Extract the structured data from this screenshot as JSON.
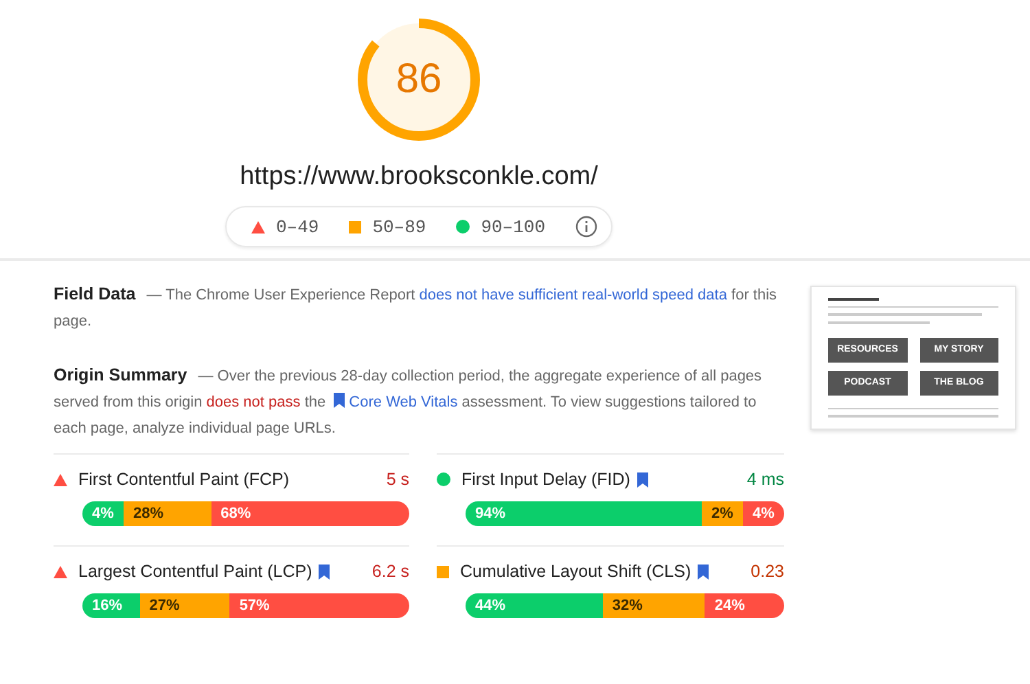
{
  "score": {
    "value": "86",
    "kind": "average"
  },
  "url": "https://www.brooksconkle.com/",
  "legend": [
    {
      "kind": "fail",
      "label": "0–49"
    },
    {
      "kind": "average",
      "label": "50–89"
    },
    {
      "kind": "pass",
      "label": "90–100"
    }
  ],
  "field_data": {
    "title": "Field Data",
    "parts": [
      {
        "kind": "plain",
        "text": "— The Chrome User Experience Report "
      },
      {
        "kind": "link",
        "text": "does not have sufficient real-world speed data"
      },
      {
        "kind": "plain",
        "text": " for this page."
      }
    ]
  },
  "origin_summary": {
    "title": "Origin Summary",
    "parts": [
      {
        "kind": "plain",
        "text": "— Over the previous 28-day collection period, the aggregate experience of all pages served from this origin "
      },
      {
        "kind": "warning",
        "text": "does not pass"
      },
      {
        "kind": "plain",
        "text": " the "
      },
      {
        "kind": "vitals-link",
        "text": "Core Web Vitals"
      },
      {
        "kind": "plain",
        "text": " assessment. To view suggestions tailored to each page, analyze individual page URLs."
      }
    ]
  },
  "thumbnail": {
    "tiles": [
      "RESOURCES",
      "MY STORY",
      "PODCAST",
      "THE BLOG"
    ]
  },
  "metrics": [
    {
      "name": "First Contentful Paint (FCP)",
      "kind": "fail",
      "core": false,
      "value": "5 s",
      "segments": [
        {
          "kind": "pass",
          "text": "4%"
        },
        {
          "kind": "average",
          "text": "28%"
        },
        {
          "kind": "fail",
          "text": "68%"
        }
      ]
    },
    {
      "name": "First Input Delay (FID)",
      "kind": "pass",
      "core": true,
      "value": "4 ms",
      "segments": [
        {
          "kind": "pass",
          "text": "94%"
        },
        {
          "kind": "average",
          "text": "2%"
        },
        {
          "kind": "fail",
          "text": "4%"
        }
      ]
    },
    {
      "name": "Largest Contentful Paint (LCP)",
      "kind": "fail",
      "core": true,
      "value": "6.2 s",
      "segments": [
        {
          "kind": "pass",
          "text": "16%"
        },
        {
          "kind": "average",
          "text": "27%"
        },
        {
          "kind": "fail",
          "text": "57%"
        }
      ]
    },
    {
      "name": "Cumulative Layout Shift (CLS)",
      "kind": "average",
      "core": true,
      "value": "0.23",
      "segments": [
        {
          "kind": "pass",
          "text": "44%"
        },
        {
          "kind": "average",
          "text": "32%"
        },
        {
          "kind": "fail",
          "text": "24%"
        }
      ]
    }
  ]
}
